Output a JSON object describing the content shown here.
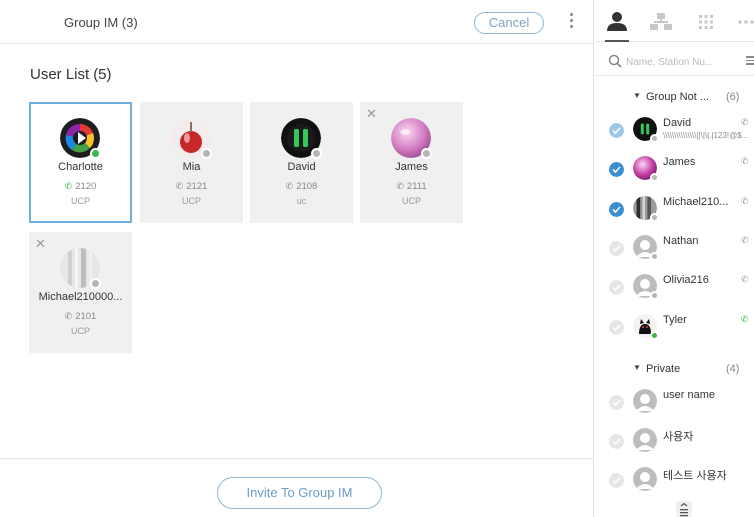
{
  "header": {
    "title": "Group IM (3)",
    "cancel_label": "Cancel"
  },
  "user_list": {
    "title": "User List",
    "count": "(5)",
    "users": [
      {
        "name": "Charlotte",
        "ext": "2120",
        "type": "UCP",
        "status": "online",
        "selected": true,
        "removable": false
      },
      {
        "name": "Mia",
        "ext": "2121",
        "type": "UCP",
        "status": "offline",
        "selected": false,
        "removable": false
      },
      {
        "name": "David",
        "ext": "2108",
        "type": "uc",
        "status": "offline",
        "selected": false,
        "removable": false
      },
      {
        "name": "James",
        "ext": "2111",
        "type": "UCP",
        "status": "offline",
        "selected": false,
        "removable": true
      },
      {
        "name": "Michael210000...",
        "ext": "2101",
        "type": "UCP",
        "status": "offline",
        "selected": false,
        "removable": true
      }
    ]
  },
  "footer": {
    "invite_label": "Invite To Group IM"
  },
  "side": {
    "search_placeholder": "Name, Station Nu...",
    "groups": [
      {
        "name": "Group Not ...",
        "count": "(6)"
      },
      {
        "name": "Private",
        "count": "(4)"
      }
    ],
    "contacts": [
      {
        "name": "David",
        "sub": "\\\\\\\\\\\\\\\\\\\\\\\\\\\\\\[|\\|\\|.|123!@$...",
        "checked": "light"
      },
      {
        "name": "James",
        "sub": "",
        "checked": "full"
      },
      {
        "name": "Michael210...",
        "sub": "",
        "checked": "full"
      },
      {
        "name": "Nathan",
        "sub": "",
        "checked": "none"
      },
      {
        "name": "Olivia216",
        "sub": "",
        "checked": "none"
      },
      {
        "name": "Tyler",
        "sub": "",
        "checked": "none"
      },
      {
        "name": "user name",
        "sub": "",
        "checked": "none"
      },
      {
        "name": "사용자",
        "sub": "",
        "checked": "none"
      },
      {
        "name": "테스트 사용자",
        "sub": "",
        "checked": "none"
      }
    ]
  },
  "colors": {
    "accent": "#3b8fd1",
    "online": "#3cb84a",
    "offline": "#b5b5b5",
    "selected_border": "#6ab0de"
  },
  "icons": [
    "user-tab-icon",
    "org-tab-icon",
    "grid-tab-icon",
    "more-tab-icon",
    "search-icon",
    "filter-icon",
    "phone-icon",
    "close-icon",
    "kebab-menu-icon",
    "list-more-icon"
  ]
}
